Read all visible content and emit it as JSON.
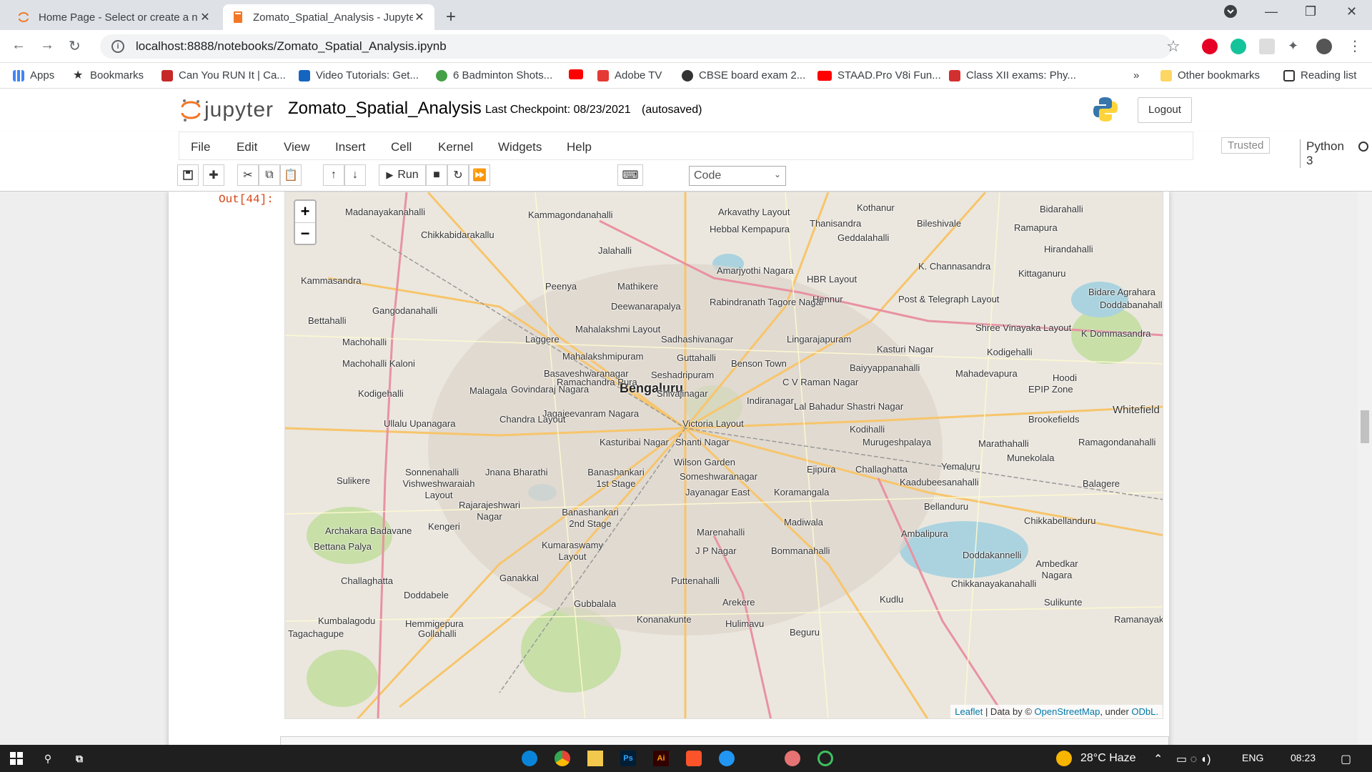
{
  "browser": {
    "tabs": [
      {
        "title": "Home Page - Select or create a n"
      },
      {
        "title": "Zomato_Spatial_Analysis - Jupyter"
      }
    ],
    "new_tab": "+",
    "url": "localhost:8888/notebooks/Zomato_Spatial_Analysis.ipynb",
    "bookmarks": [
      {
        "label": "Apps",
        "color": "#4285f4"
      },
      {
        "label": "Bookmarks",
        "color": "#5f6368"
      },
      {
        "label": "Can You RUN It | Ca...",
        "color": "#c62828"
      },
      {
        "label": "Video Tutorials: Get...",
        "color": "#1565c0"
      },
      {
        "label": "6 Badminton Shots...",
        "color": "#43a047"
      },
      {
        "label": "",
        "color": "#ff0000"
      },
      {
        "label": "Adobe TV",
        "color": "#e53935"
      },
      {
        "label": "CBSE board exam 2...",
        "color": "#333333"
      },
      {
        "label": "STAAD.Pro V8i Fun...",
        "color": "#ff0000"
      },
      {
        "label": "Class XII exams: Phy...",
        "color": "#d32f2f"
      }
    ],
    "more_bookmarks": "»",
    "other_bookmarks": "Other bookmarks",
    "reading_list": "Reading list"
  },
  "jupyter": {
    "logo_text": "jupyter",
    "notebook_name": "Zomato_Spatial_Analysis",
    "checkpoint": "Last Checkpoint: 08/23/2021",
    "autosave": "(autosaved)",
    "logout": "Logout",
    "menu": [
      "File",
      "Edit",
      "View",
      "Insert",
      "Cell",
      "Kernel",
      "Widgets",
      "Help"
    ],
    "trusted": "Trusted",
    "kernel": "Python 3",
    "run_label": "Run",
    "cell_type": "Code",
    "out_prompt": "Out[44]:"
  },
  "map": {
    "city": "Bengaluru",
    "zoom_in": "+",
    "zoom_out": "−",
    "attribution": {
      "leaflet": "Leaflet",
      "data_by": " | Data by © ",
      "osm": "OpenStreetMap",
      "under": ", under ",
      "odbl": "ODbL."
    },
    "labels": [
      "Madanayakanahalli",
      "Kammagondanahalli",
      "Arkavathy Layout",
      "Kothanur",
      "Bidarahalli",
      "Chikkabidarakallu",
      "Hebbal Kempapura",
      "Thanisandra",
      "Bileshivale",
      "Ramapura",
      "Jalahalli",
      "Geddalahalli",
      "Hirandahalli",
      "Kammasandra",
      "Amarjyothi Nagara",
      "K. Channasandra",
      "Kittaganuru",
      "Peenya",
      "Mathikere",
      "HBR Layout",
      "Bidare Agrahara",
      "Gangodanahalli",
      "Deewanarapalya",
      "Rabindranath Tagore Nagar",
      "Hennur",
      "Post & Telegraph Layout",
      "Doddabanahalli",
      "Bettahalli",
      "Mahalakshmi Layout",
      "Laggere",
      "Sadhashivanagar",
      "Lingarajapuram",
      "Shree Vinayaka Layout",
      "K Dommasandra",
      "Machohalli",
      "Kasturi Nagar",
      "Kodigehalli",
      "Machohalli Kaloni",
      "Mahalakshmipuram",
      "Guttahalli",
      "Benson Town",
      "Baiyyappanahalli",
      "Basaveshwaranagar",
      "Seshadripuram",
      "Mahadevapura",
      "Hoodi",
      "Ramachandra Pura",
      "Shivajinagar",
      "C V Raman Nagar",
      "Kodigehalli",
      "Malagala",
      "Govindaraj Nagara",
      "EPIP Zone",
      "Indiranagar",
      "Whitefield",
      "Jagajeevanram Nagara",
      "Lal Bahadur Shastri Nagar",
      "Ullalu Upanagara",
      "Chandra Layout",
      "Victoria Layout",
      "Kodihalli",
      "Brookefields",
      "Kasturibai Nagar",
      "Shanti Nagar",
      "Murugeshpalaya",
      "Marathahalli",
      "Ramagondanahalli",
      "Wilson Garden",
      "Munekolala",
      "Sonnenahalli",
      "Jnana Bharathi",
      "Banashankari 1st Stage",
      "Ejipura",
      "Challaghatta",
      "Yemaluru",
      "Sulikere",
      "Vishweshwaraiah Layout",
      "Someshwaranagar",
      "Kaadubeesanahalli",
      "Balagere",
      "Jayanagar East",
      "Koramangala",
      "Rajarajeshwari Nagar",
      "Banashankari 2nd Stage",
      "Bellanduru",
      "Archakara Badavane",
      "Kengeri",
      "Madiwala",
      "Chikkabellanduru",
      "Marenahalli",
      "Ambalipura",
      "Bettana Palya",
      "Kumaraswamy Layout",
      "J P Nagar",
      "Bommanahalli",
      "Doddakannelli",
      "Ambedkar Nagara",
      "Challaghatta",
      "Ganakkal",
      "Puttenahalli",
      "Chikkanayakanahalli",
      "Doddabele",
      "Gubbalala",
      "Arekere",
      "Kudlu",
      "Sulikunte",
      "Kumbalagodu",
      "Konanakunte",
      "Hulimavu",
      "Hemmigepura",
      "Beguru",
      "Tagachagupe",
      "Gollahalli",
      "Ramanayak"
    ]
  },
  "taskbar": {
    "weather": "28°C  Haze",
    "lang": "ENG",
    "time": "08:23"
  }
}
